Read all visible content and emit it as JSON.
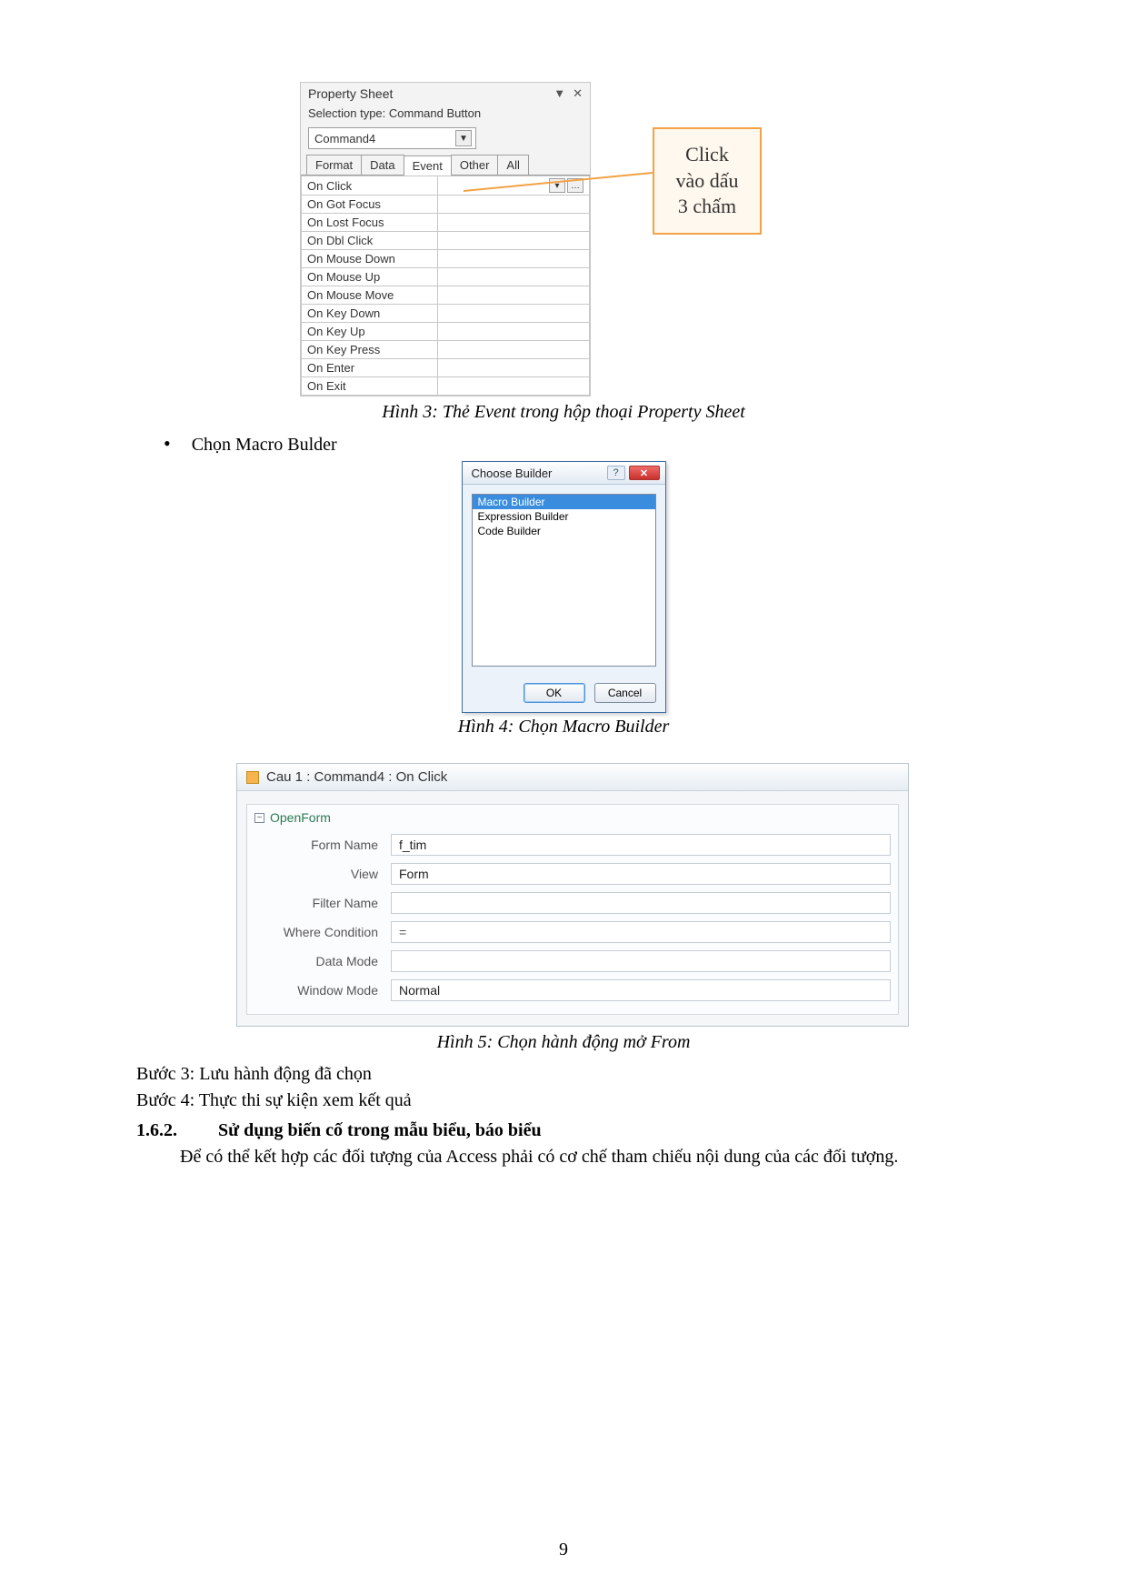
{
  "callout": {
    "line1": "Click",
    "line2": "vào dấu",
    "line3": "3 chấm"
  },
  "property_sheet": {
    "title": "Property Sheet",
    "subtitle": "Selection type:  Command Button",
    "combo_value": "Command4",
    "tabs": [
      "Format",
      "Data",
      "Event",
      "Other",
      "All"
    ],
    "active_tab_index": 2,
    "events": [
      "On Click",
      "On Got Focus",
      "On Lost Focus",
      "On Dbl Click",
      "On Mouse Down",
      "On Mouse Up",
      "On Mouse Move",
      "On Key Down",
      "On Key Up",
      "On Key Press",
      "On Enter",
      "On Exit"
    ]
  },
  "caption3": "Hình 3: Thẻ Event trong hộp thoại Property Sheet",
  "bullet1": "Chọn Macro Bulder",
  "choose_builder": {
    "title": "Choose Builder",
    "items": [
      "Macro Builder",
      "Expression Builder",
      "Code Builder"
    ],
    "selected_index": 0,
    "ok": "OK",
    "cancel": "Cancel"
  },
  "caption4": "Hình 4: Chọn Macro Builder",
  "macro": {
    "tab_title": "Cau 1 : Command4 : On Click",
    "action_name": "OpenForm",
    "params": [
      {
        "label": "Form Name",
        "value": "f_tim"
      },
      {
        "label": "View",
        "value": "Form"
      },
      {
        "label": "Filter Name",
        "value": ""
      },
      {
        "label": "Where Condition",
        "value": "",
        "prefix": "="
      },
      {
        "label": "Data Mode",
        "value": ""
      },
      {
        "label": "Window Mode",
        "value": "Normal"
      }
    ]
  },
  "caption5": "Hình 5: Chọn hành động mở From",
  "step3": "Bước 3: Lưu hành động đã chọn",
  "step4": "Bước 4: Thực thi sự kiện xem kết quả",
  "section": {
    "number": "1.6.2.",
    "title": "Sử dụng biến cố trong mẫu biểu, báo biểu"
  },
  "para": "Để có thể kết hợp các đối tượng của Access phải có cơ chế tham chiếu nội dung của các đối tượng.",
  "page_number": "9"
}
